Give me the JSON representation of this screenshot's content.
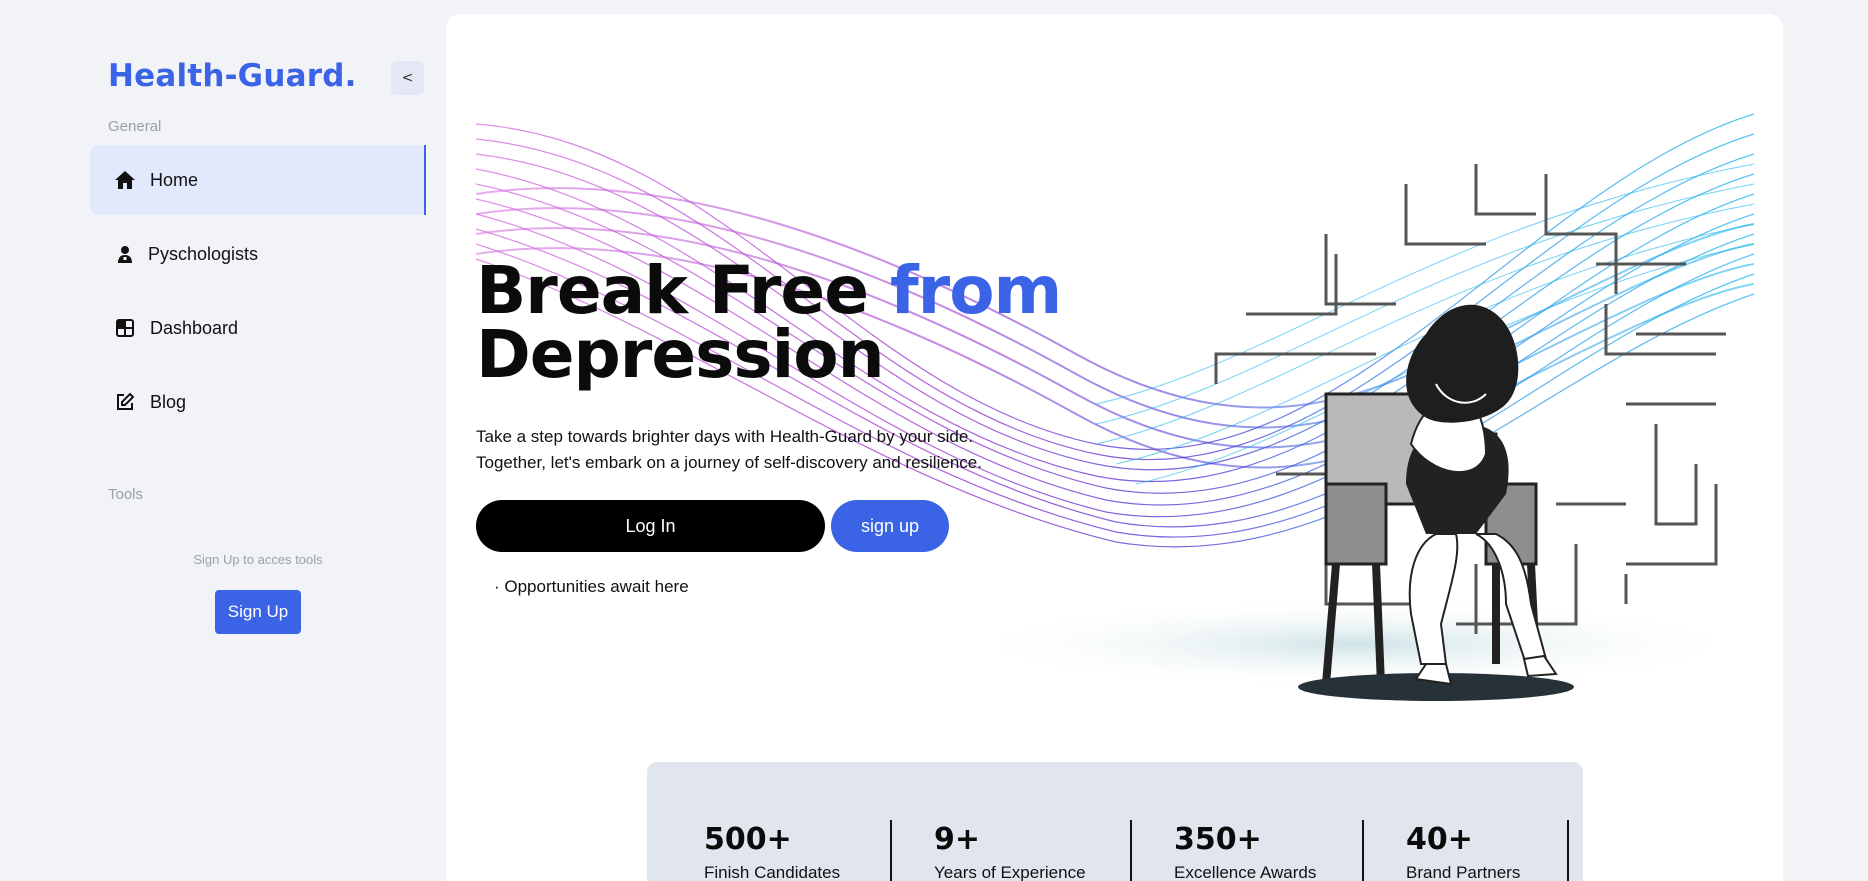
{
  "sidebar": {
    "brand": "Health-Guard.",
    "collapse_label": "<",
    "general_label": "General",
    "items": [
      {
        "label": "Home",
        "icon": "home-icon"
      },
      {
        "label": "Pyschologists",
        "icon": "person-icon"
      },
      {
        "label": "Dashboard",
        "icon": "grid-icon"
      },
      {
        "label": "Blog",
        "icon": "edit-icon"
      }
    ],
    "tools_label": "Tools",
    "tools_hint": "Sign Up to acces tools",
    "signup_label": "Sign Up"
  },
  "hero": {
    "headline_part1": "Break Free ",
    "headline_accent": "from",
    "headline_line2": "Depression",
    "subtext_line1": "Take a step towards brighter days with Health-Guard by your side.",
    "subtext_line2": "Together, let's embark on a journey of self-discovery and resilience.",
    "login_label": "Log In",
    "signup_label": "sign up",
    "opportunities": "· Opportunities await here"
  },
  "stats": [
    {
      "value": "500+",
      "label": "Finish Candidates"
    },
    {
      "value": "9+",
      "label": "Years of Experience"
    },
    {
      "value": "350+",
      "label": "Excellence Awards"
    },
    {
      "value": "40+",
      "label": "Brand Partners"
    }
  ],
  "colors": {
    "accent": "#3b63e6",
    "background": "#f1f3f7",
    "active_nav": "#e3e9fd",
    "stats_bg": "#e1e6ee"
  }
}
